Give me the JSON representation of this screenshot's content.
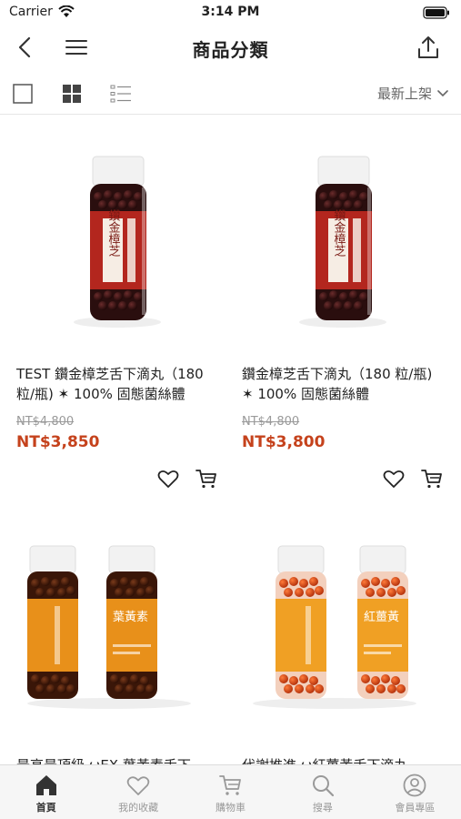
{
  "status": {
    "carrier": "Carrier",
    "time": "3:14 PM"
  },
  "nav": {
    "title": "商品分類"
  },
  "toolbar": {
    "sort_label": "最新上架"
  },
  "products": [
    {
      "name": "TEST 鑽金樟芝舌下滴丸（180 粒/瓶) ✶ 100% 固態菌絲體",
      "original_price": "NT$4,800",
      "price": "NT$3,850",
      "label_text": "鑽金樟芝",
      "theme": "red"
    },
    {
      "name": "鑽金樟芝舌下滴丸（180 粒/瓶) ✶ 100% 固態菌絲體",
      "original_price": "NT$4,800",
      "price": "NT$3,800",
      "label_text": "鑽金樟芝",
      "theme": "red"
    },
    {
      "name": "最高最頂級 ωEX 葉黃素舌下",
      "original_price": "",
      "price": "",
      "label_text": "葉黃素",
      "theme": "orange-brown"
    },
    {
      "name": "代謝推進 ω紅薑黃舌下滴丸",
      "original_price": "",
      "price": "",
      "label_text": "紅薑黃",
      "theme": "orange-red"
    }
  ],
  "tabs": [
    {
      "label": "首頁",
      "icon": "home-icon",
      "active": true
    },
    {
      "label": "我的收藏",
      "icon": "heart-icon",
      "active": false
    },
    {
      "label": "購物車",
      "icon": "cart-icon",
      "active": false
    },
    {
      "label": "搜尋",
      "icon": "search-icon",
      "active": false
    },
    {
      "label": "會員專區",
      "icon": "user-icon",
      "active": false
    }
  ],
  "colors": {
    "price": "#c5421c",
    "accent_red": "#b3261e",
    "accent_orange": "#e8901a"
  }
}
